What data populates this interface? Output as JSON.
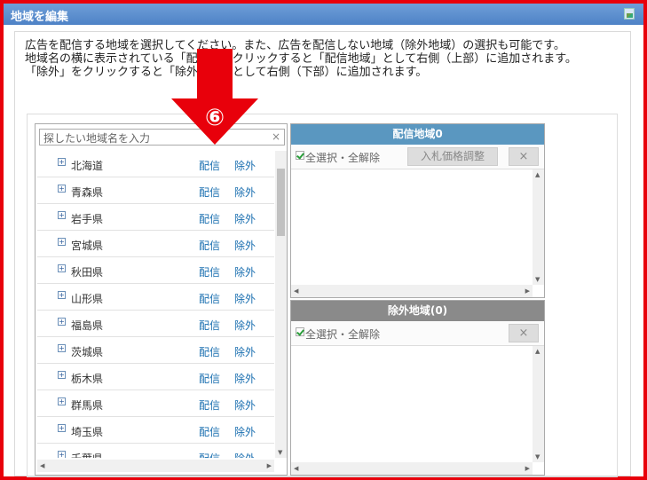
{
  "dialog": {
    "title": "地域を編集"
  },
  "description": [
    "広告を配信する地域を選択してください。また、広告を配信しない地域（除外地域）の選択も可能です。",
    "地域名の横に表示されている「配信」をクリックすると「配信地域」として右側（上部）に追加されます。",
    "「除外」をクリックすると「除外地域」として右側（下部）に追加されます。"
  ],
  "search": {
    "placeholder": "探したい地域名を入力",
    "clear": "×"
  },
  "regions": [
    {
      "name": "北海道",
      "deliver": "配信",
      "exclude": "除外"
    },
    {
      "name": "青森県",
      "deliver": "配信",
      "exclude": "除外"
    },
    {
      "name": "岩手県",
      "deliver": "配信",
      "exclude": "除外"
    },
    {
      "name": "宮城県",
      "deliver": "配信",
      "exclude": "除外"
    },
    {
      "name": "秋田県",
      "deliver": "配信",
      "exclude": "除外"
    },
    {
      "name": "山形県",
      "deliver": "配信",
      "exclude": "除外"
    },
    {
      "name": "福島県",
      "deliver": "配信",
      "exclude": "除外"
    },
    {
      "name": "茨城県",
      "deliver": "配信",
      "exclude": "除外"
    },
    {
      "name": "栃木県",
      "deliver": "配信",
      "exclude": "除外"
    },
    {
      "name": "群馬県",
      "deliver": "配信",
      "exclude": "除外"
    },
    {
      "name": "埼玉県",
      "deliver": "配信",
      "exclude": "除外"
    },
    {
      "name": "千葉県",
      "deliver": "配信",
      "exclude": "除外"
    }
  ],
  "deliveryPanel": {
    "title": "配信地域0",
    "selectAll": "全選択・全解除",
    "bidButton": "入札価格調整",
    "removeButton": "×"
  },
  "excludePanel": {
    "title": "除外地域(0)",
    "selectAll": "全選択・全解除",
    "removeButton": "×"
  },
  "annotation": {
    "label": "⑥",
    "color": "#e8000b"
  }
}
